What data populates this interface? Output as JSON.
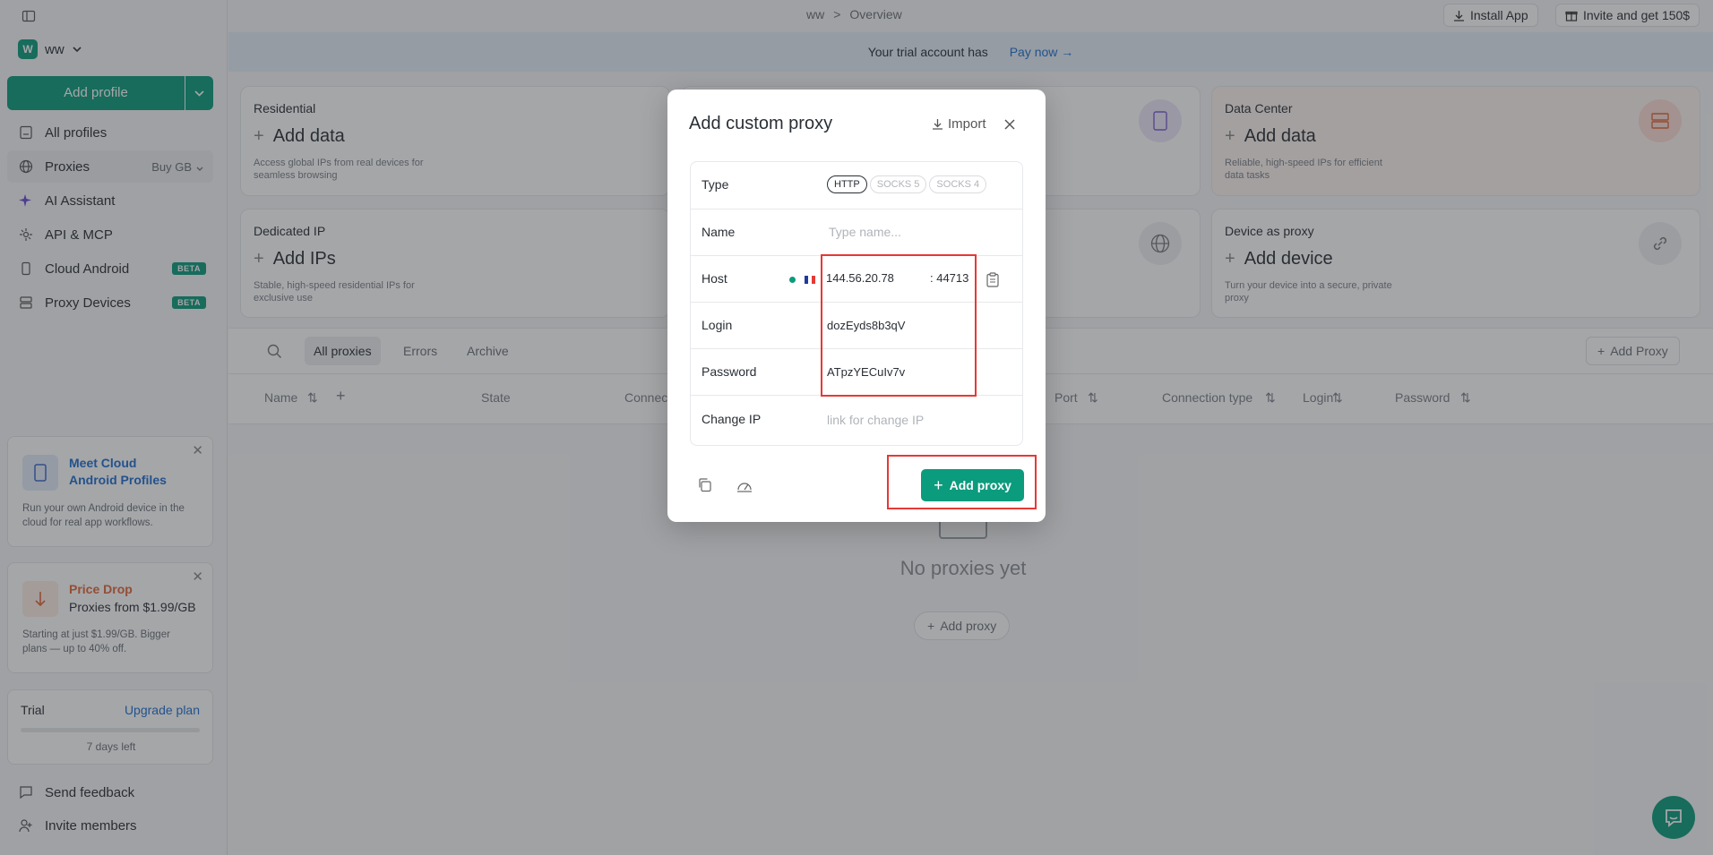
{
  "topbar": {
    "breadcrumb_ws": "ww",
    "breadcrumb_sep": ">",
    "breadcrumb_page": "Overview",
    "install_app": "Install App",
    "invite": "Invite and get 150$"
  },
  "trial_banner": {
    "text": "Your trial account has",
    "pay_now": "Pay now →"
  },
  "sidebar": {
    "workspace_initial": "W",
    "workspace_name": "ww",
    "add_profile": "Add profile",
    "items": [
      {
        "label": "All profiles"
      },
      {
        "label": "Proxies",
        "extra": "Buy GB"
      },
      {
        "label": "AI Assistant"
      },
      {
        "label": "API & MCP"
      },
      {
        "label": "Cloud Android",
        "badge": "BETA"
      },
      {
        "label": "Proxy Devices",
        "badge": "BETA"
      }
    ],
    "promo_cloud": {
      "title": "Meet Cloud Android Profiles",
      "text": "Run your own Android device in the cloud for real app workflows."
    },
    "promo_price": {
      "title": "Price Drop",
      "subtitle": "Proxies from $1.99/GB",
      "text": "Starting at just $1.99/GB. Bigger plans — up to 40% off."
    },
    "trial": {
      "label": "Trial",
      "upgrade": "Upgrade plan",
      "days_left": "7 days left",
      "progress": 0.0
    },
    "send_feedback": "Send feedback",
    "invite_members": "Invite members"
  },
  "cards": {
    "residential": {
      "label": "Residential",
      "action": "Add data",
      "desc": "Access global IPs from real devices for seamless browsing"
    },
    "data_center": {
      "label": "Data Center",
      "action": "Add data",
      "desc": "Reliable, high-speed IPs for efficient data tasks"
    },
    "dedicated": {
      "label": "Dedicated IP",
      "action": "Add IPs",
      "desc": "Stable, high-speed residential IPs for exclusive use"
    },
    "device": {
      "label": "Device as proxy",
      "action": "Add device",
      "desc": "Turn your device into a secure, private proxy"
    }
  },
  "tabs": {
    "all": "All proxies",
    "errors": "Errors",
    "archive": "Archive",
    "add_proxy": "Add Proxy"
  },
  "table_headers": {
    "name": "Name",
    "state": "State",
    "connection": "Connec",
    "port": "Port",
    "connection_type": "Connection type",
    "login": "Login",
    "password": "Password"
  },
  "empty": {
    "text": "No proxies yet",
    "button": "Add proxy"
  },
  "modal": {
    "title": "Add custom proxy",
    "import": "Import",
    "type_label": "Type",
    "types": [
      "HTTP",
      "SOCKS 5",
      "SOCKS 4"
    ],
    "name_label": "Name",
    "name_placeholder": "Type name...",
    "host_label": "Host",
    "host_value": "144.56.20.78",
    "port_value": ": 44713",
    "login_label": "Login",
    "login_value": "dozEyds8b3qV",
    "password_label": "Password",
    "password_value": "ATpzYECuIv7v",
    "change_ip_label": "Change IP",
    "change_ip_placeholder": "link for change IP",
    "submit": "Add proxy"
  },
  "colors": {
    "accent": "#0b9b7d",
    "highlight": "#e53935",
    "link": "#1f6fcf"
  }
}
